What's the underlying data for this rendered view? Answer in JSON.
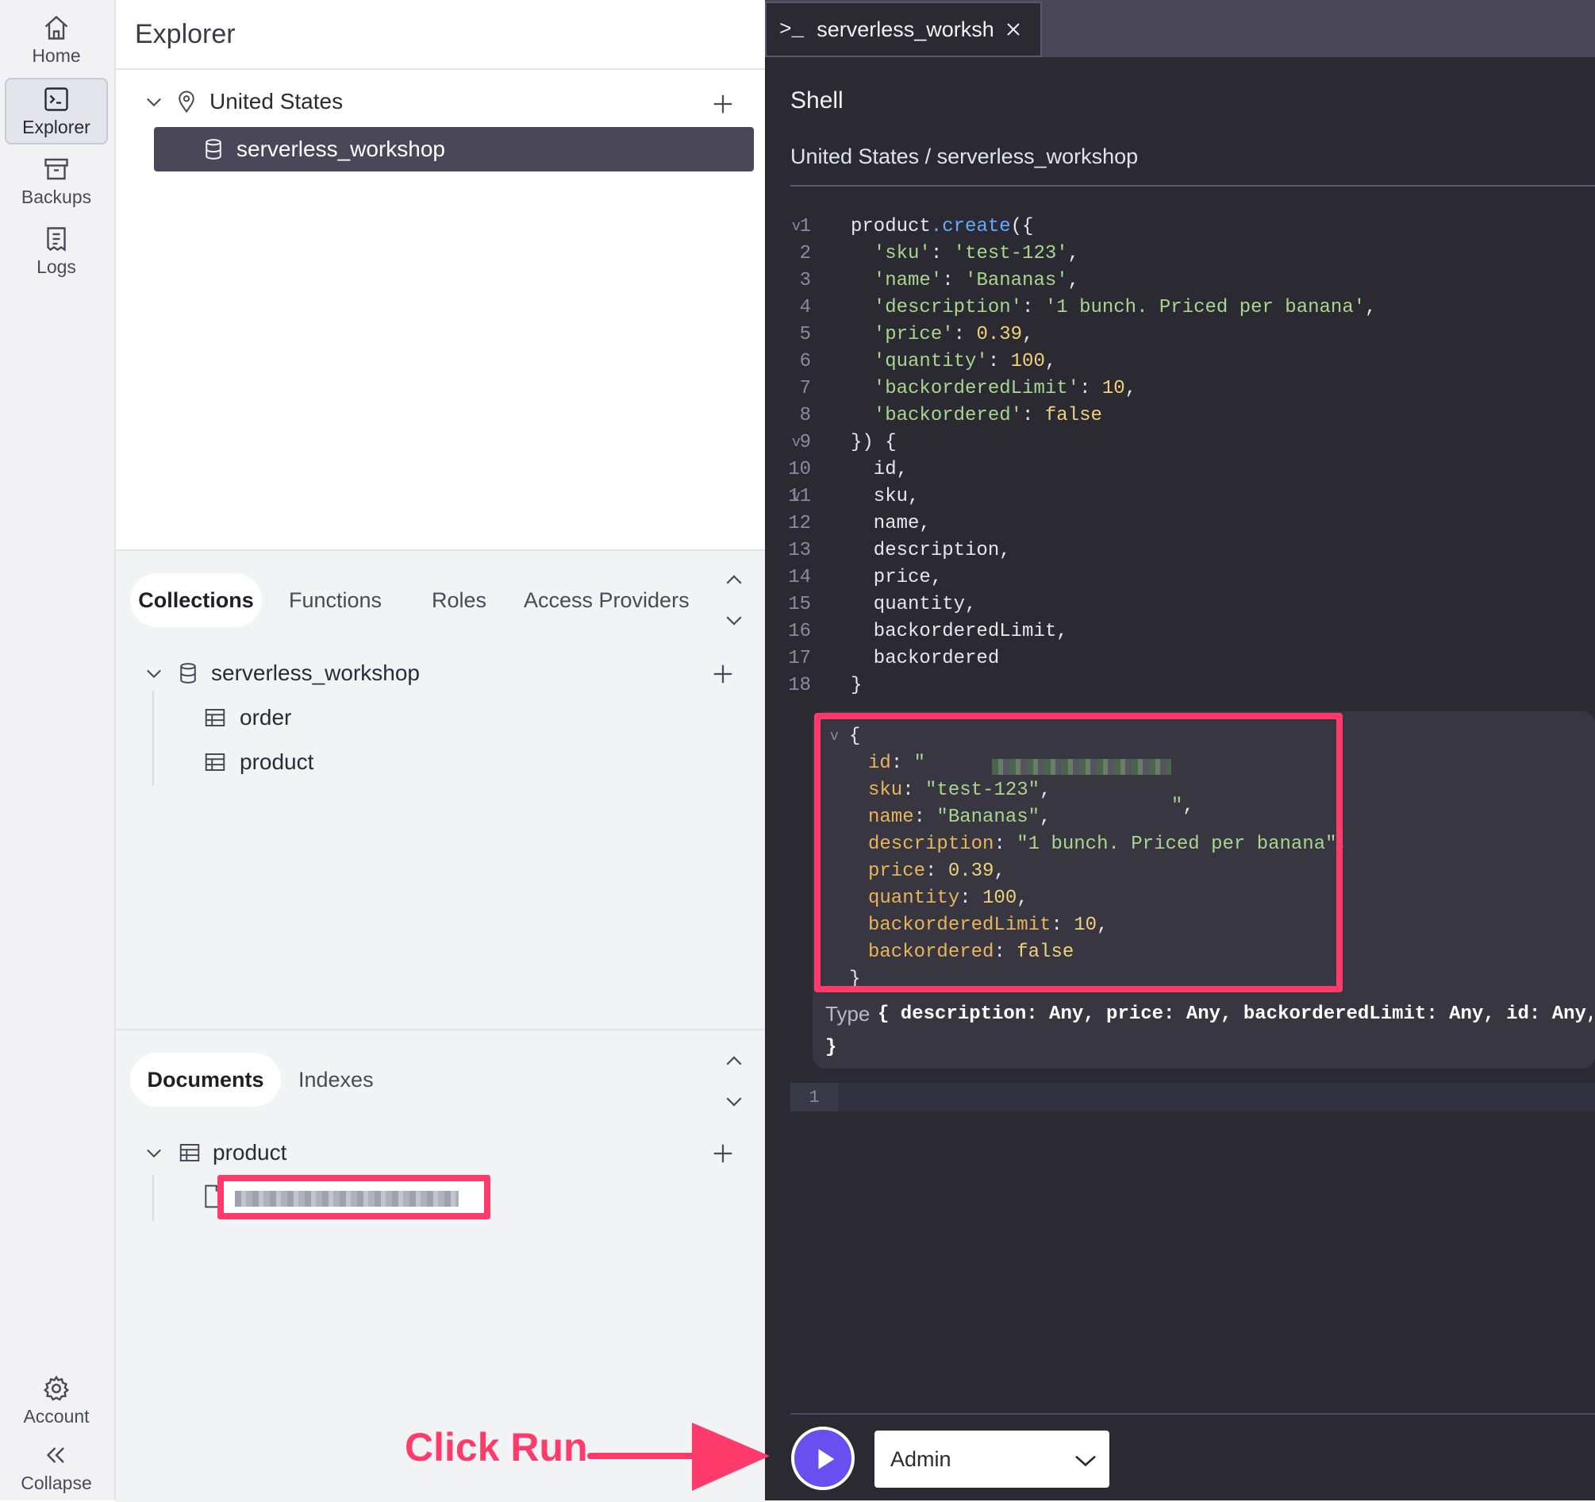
{
  "nav": {
    "items": [
      {
        "label": "Home",
        "icon": "home-icon"
      },
      {
        "label": "Explorer",
        "icon": "terminal-icon"
      },
      {
        "label": "Backups",
        "icon": "archive-icon"
      },
      {
        "label": "Logs",
        "icon": "logs-icon"
      }
    ],
    "bottom": [
      {
        "label": "Account",
        "icon": "gear-icon"
      },
      {
        "label": "Collapse",
        "icon": "double-chevron-left-icon"
      }
    ]
  },
  "explorer": {
    "title": "Explorer",
    "region": "United States",
    "database": "serverless_workshop",
    "collections_section": {
      "tabs": [
        "Collections",
        "Functions",
        "Roles",
        "Access Providers"
      ],
      "database": "serverless_workshop",
      "collections": [
        "order",
        "product"
      ]
    },
    "documents_section": {
      "tabs": [
        "Documents",
        "Indexes"
      ],
      "collection": "product"
    }
  },
  "shell": {
    "tab_label": "serverless_worksh",
    "title": "Shell",
    "breadcrumb": "United States / serverless_workshop",
    "code_lines": [
      "product.create({",
      "  'sku': 'test-123',",
      "  'name': 'Bananas',",
      "  'description': '1 bunch. Priced per banana',",
      "  'price': 0.39,",
      "  'quantity': 100,",
      "  'backorderedLimit': 10,",
      "  'backordered': false",
      "}) {",
      "  id,",
      "  sku,",
      "  name,",
      "  description,",
      "  price,",
      "  quantity,",
      "  backorderedLimit,",
      "  backordered",
      "}"
    ],
    "result": {
      "open": "{",
      "id_key": "id",
      "sku": "\"test-123\"",
      "name": "\"Bananas\"",
      "description": "\"1 bunch. Priced per banana\"",
      "price": "0.39",
      "quantity": "100",
      "backorderedLimit": "10",
      "backordered": "false",
      "close": "}"
    },
    "type_label": "Type",
    "type_value": "{ description: Any, price: Any, backorderedLimit: Any, id: Any,",
    "type_close": "}",
    "editor2_line": "1",
    "role": "Admin"
  },
  "annotation": {
    "text": "Click Run",
    "color": "#ff3b6b"
  },
  "colors": {
    "accent": "#6a4ff0",
    "highlight": "#ff3b6b",
    "shell_bg": "#2b2a33",
    "selected_row": "#4a4858"
  }
}
